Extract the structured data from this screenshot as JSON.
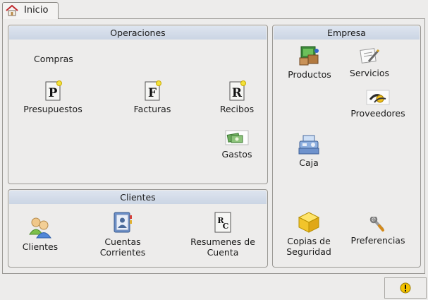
{
  "tab": {
    "label": "Inicio"
  },
  "operaciones": {
    "title": "Operaciones",
    "compras": "Compras",
    "presupuestos": "Presupuestos",
    "facturas": "Facturas",
    "recibos": "Recibos",
    "gastos": "Gastos"
  },
  "clientes_panel": {
    "title": "Clientes",
    "clientes": "Clientes",
    "cuentas_l1": "Cuentas",
    "cuentas_l2": "Corrientes",
    "resumenes_l1": "Resumenes de",
    "resumenes_l2": "Cuenta"
  },
  "empresa": {
    "title": "Empresa",
    "productos": "Productos",
    "servicios": "Servicios",
    "proveedores": "Proveedores",
    "caja": "Caja",
    "copias_l1": "Copias de",
    "copias_l2": "Seguridad",
    "preferencias": "Preferencias"
  },
  "doc_letters": {
    "p": "P",
    "f": "F",
    "r": "R",
    "rc_r": "R",
    "rc_c": "C"
  }
}
